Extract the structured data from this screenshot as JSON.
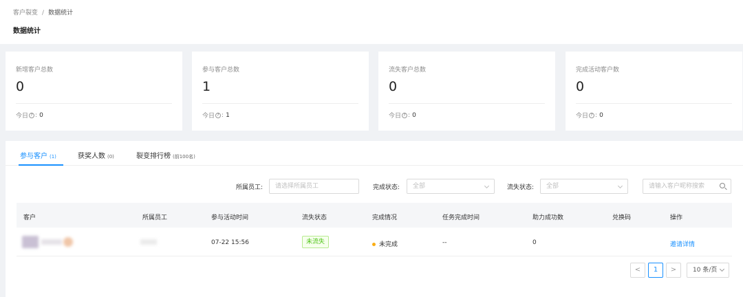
{
  "breadcrumb": {
    "parent": "客户裂变",
    "separator": "/",
    "current": "数据统计"
  },
  "page_title": "数据统计",
  "stats": [
    {
      "label": "新增客户总数",
      "value": "0",
      "today_label": "今日",
      "today_value": "0"
    },
    {
      "label": "参与客户总数",
      "value": "1",
      "today_label": "今日",
      "today_value": "1"
    },
    {
      "label": "流失客户总数",
      "value": "0",
      "today_label": "今日",
      "today_value": "0"
    },
    {
      "label": "完成活动客户数",
      "value": "0",
      "today_label": "今日",
      "today_value": "0"
    }
  ],
  "tabs": [
    {
      "label": "参与客户",
      "count": "(1)"
    },
    {
      "label": "获奖人数",
      "count": "(0)"
    },
    {
      "label": "裂变排行榜",
      "count": "(前100名)"
    }
  ],
  "filters": {
    "staff_label": "所属员工:",
    "staff_placeholder": "请选择所属员工",
    "complete_label": "完成状态:",
    "complete_value": "全部",
    "churn_label": "流失状态:",
    "churn_value": "全部",
    "search_placeholder": "请输入客户昵称搜索"
  },
  "table": {
    "columns": [
      "客户",
      "所属员工",
      "参与活动时间",
      "流失状态",
      "完成情况",
      "任务完成时间",
      "助力成功数",
      "兑换码",
      "操作"
    ],
    "rows": [
      {
        "join_time": "07-22 15:56",
        "churn_status": "未流失",
        "completion": "未完成",
        "task_time": "--",
        "assist_count": "0",
        "action": "邀请详情"
      }
    ]
  },
  "pagination": {
    "prev": "<",
    "page": "1",
    "next": ">",
    "page_size": "10 条/页"
  },
  "colors": {
    "primary": "#1890ff",
    "success": "#52c41a",
    "warning": "#faad14"
  }
}
